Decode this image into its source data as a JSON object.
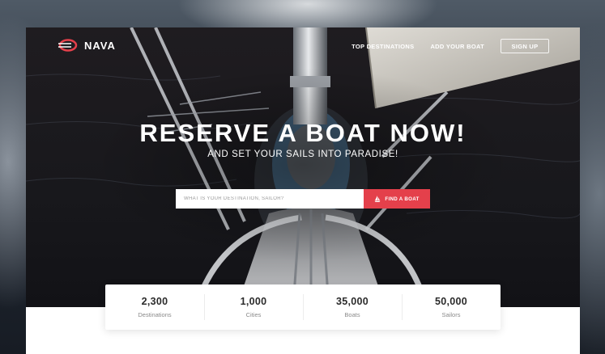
{
  "brand": {
    "name": "NAVA",
    "logo_icon": "nava-logo-icon"
  },
  "nav": {
    "links": [
      "TOP DESTINATIONS",
      "ADD YOUR BOAT"
    ],
    "signup_label": "SIGN UP"
  },
  "hero": {
    "headline": "RESERVE A BOAT NOW!",
    "subline": "AND SET YOUR SAILS INTO PARADISE!"
  },
  "search": {
    "placeholder": "WHAT IS YOUR DESTINATION, SAILOR?",
    "button_label": "FIND A BOAT",
    "button_icon": "sailboat-icon"
  },
  "stats": [
    {
      "value": "2,300",
      "label": "Destinations"
    },
    {
      "value": "1,000",
      "label": "Cities"
    },
    {
      "value": "35,000",
      "label": "Boats"
    },
    {
      "value": "50,000",
      "label": "Sailors"
    }
  ],
  "colors": {
    "accent": "#e4404b",
    "hero_dark": "#18181c",
    "stat_text": "#2b2b2b",
    "stat_label": "#8a8a8a"
  }
}
